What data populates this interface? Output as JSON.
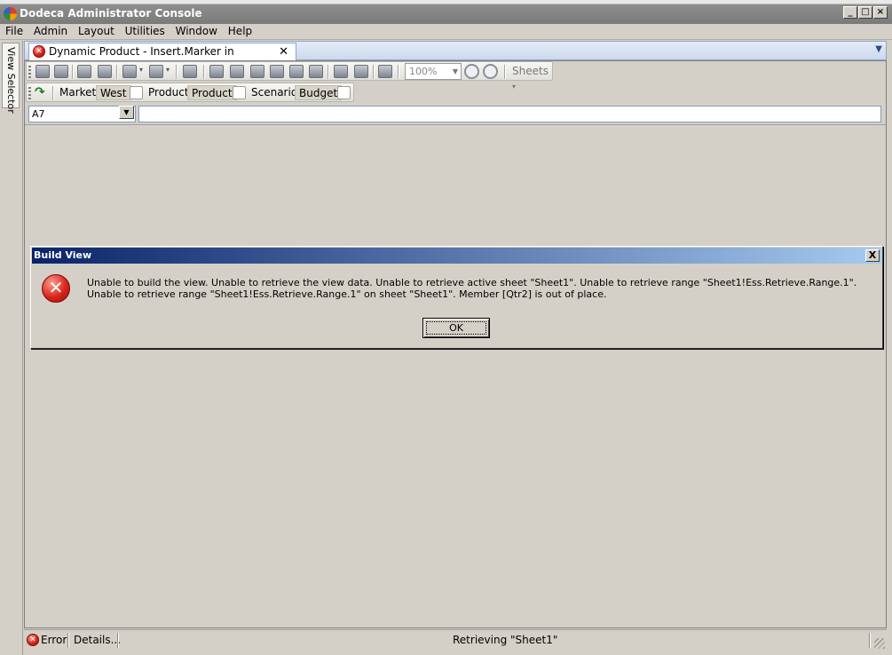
{
  "window": {
    "title": "Dodeca Administrator Console",
    "controls": [
      "_",
      "□",
      "×"
    ]
  },
  "menu": [
    "File",
    "Admin",
    "Layout",
    "Utilities",
    "Window",
    "Help"
  ],
  "left_selector": {
    "label": "View Selector"
  },
  "document_tab": {
    "title": "Dynamic Product - Insert.Marker in Row.Template",
    "close": "✕",
    "dropdown": "▼"
  },
  "toolbar": {
    "zoom": "100%",
    "sheets_label": "Sheets"
  },
  "pov": {
    "refresh_icon": "↷",
    "dimensions": [
      {
        "label": "Market",
        "member": "West"
      },
      {
        "label": "Product",
        "member": "Product"
      },
      {
        "label": "Scenario",
        "member": "Budget"
      }
    ]
  },
  "cell_reference": {
    "value": "A7",
    "dropdown": "▼"
  },
  "dialog": {
    "title": "Build View",
    "close": "X",
    "icon": "error-icon",
    "message": "Unable to build the view. Unable to retrieve the view data. Unable to retrieve active sheet \"Sheet1\". Unable to retrieve range \"Sheet1!Ess.Retrieve.Range.1\". Unable to retrieve range \"Sheet1!Ess.Retrieve.Range.1\" on sheet \"Sheet1\". Member [Qtr2] is out of place.",
    "ok_label": "OK"
  },
  "status": {
    "error_label": "Error",
    "details_label": "Details...",
    "message": "Retrieving \"Sheet1\""
  },
  "colors": {
    "dialog_title_start": "#0a246a",
    "dialog_title_end": "#a6caf0",
    "error_red": "#d8261a",
    "window_face": "#d4d0c8"
  }
}
